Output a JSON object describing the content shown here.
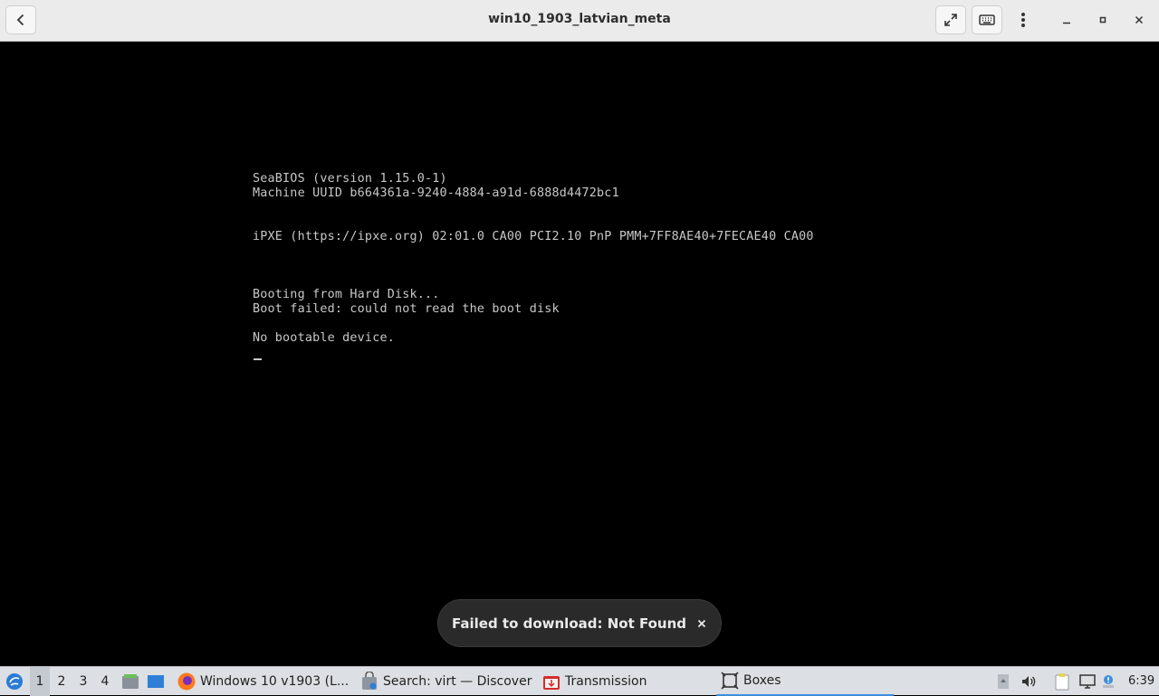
{
  "window": {
    "title": "win10_1903_latvian_meta"
  },
  "console": {
    "lines": [
      "SeaBIOS (version 1.15.0-1)",
      "Machine UUID b664361a-9240-4884-a91d-6888d4472bc1",
      "iPXE (https://ipxe.org) 02:01.0 CA00 PCI2.10 PnP PMM+7FF8AE40+7FECAE40 CA00",
      "Booting from Hard Disk...",
      "Boot failed: could not read the boot disk",
      "No bootable device."
    ]
  },
  "toast": {
    "message": "Failed to download: Not Found"
  },
  "taskbar": {
    "workspaces": [
      "1",
      "2",
      "3",
      "4"
    ],
    "tasks": [
      {
        "label": "Windows 10 v1903 (L..."
      },
      {
        "label": "Search: virt — Discover"
      },
      {
        "label": "Transmission"
      },
      {
        "label": "Boxes"
      }
    ],
    "clock": "6:39"
  },
  "colors": {
    "accent": "#3d8ee0",
    "console_text": "#c8c8c8",
    "toast_bg": "#2a2a2a"
  }
}
